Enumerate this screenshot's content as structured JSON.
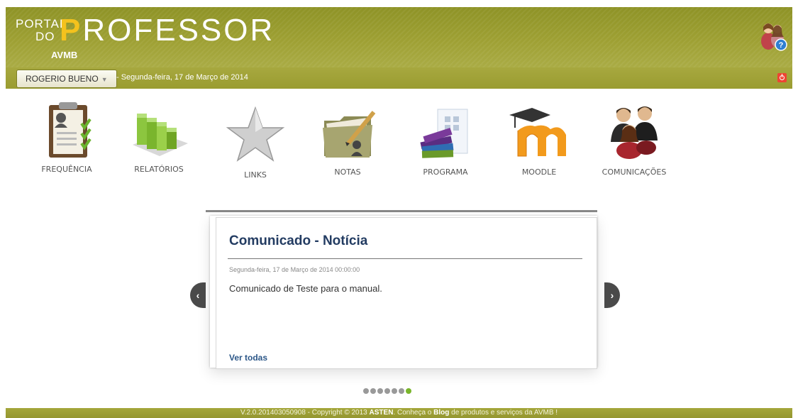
{
  "header": {
    "logo_portal": "PORTAL",
    "logo_do": "DO",
    "logo_professor_p": "P",
    "logo_professor_rest": "ROFESSOR",
    "logo_sub": "AVMB",
    "help_icon": "help-avatar-icon"
  },
  "toolbar": {
    "user_label": "ROGERIO BUENO",
    "date_text": "- Segunda-feira, 17 de Março de 2014",
    "power_icon": "power-icon"
  },
  "menu": [
    {
      "label": "FREQUÊNCIA",
      "icon": "attendance-clipboard-icon"
    },
    {
      "label": "RELATÓRIOS",
      "icon": "reports-bars-icon"
    },
    {
      "label": "LINKS",
      "icon": "star-icon"
    },
    {
      "label": "NOTAS",
      "icon": "grades-folder-icon"
    },
    {
      "label": "PROGRAMA",
      "icon": "books-icon"
    },
    {
      "label": "MOODLE",
      "icon": "moodle-icon"
    },
    {
      "label": "COMUNICAÇÕES",
      "icon": "people-icon"
    }
  ],
  "news": {
    "title": "Comunicado - Notícia",
    "date": "Segunda-feira, 17 de Março de 2014 00:00:00",
    "body": "Comunicado de Teste para o manual.",
    "more_link": "Ver todas",
    "prev_glyph": "‹",
    "next_glyph": "›",
    "page_count": 7,
    "active_page": 7
  },
  "footer": {
    "version": "V.2.0.201403050908 - Copyright © 2013",
    "company": "ASTEN",
    "mid": ". Conheça o",
    "blog": "Blog",
    "tail": "de produtos e serviços da AVMB !"
  },
  "colors": {
    "header_olive": "#9ea033",
    "accent_yellow": "#f4c21d",
    "title_navy": "#233c62",
    "active_dot": "#79b52b"
  }
}
